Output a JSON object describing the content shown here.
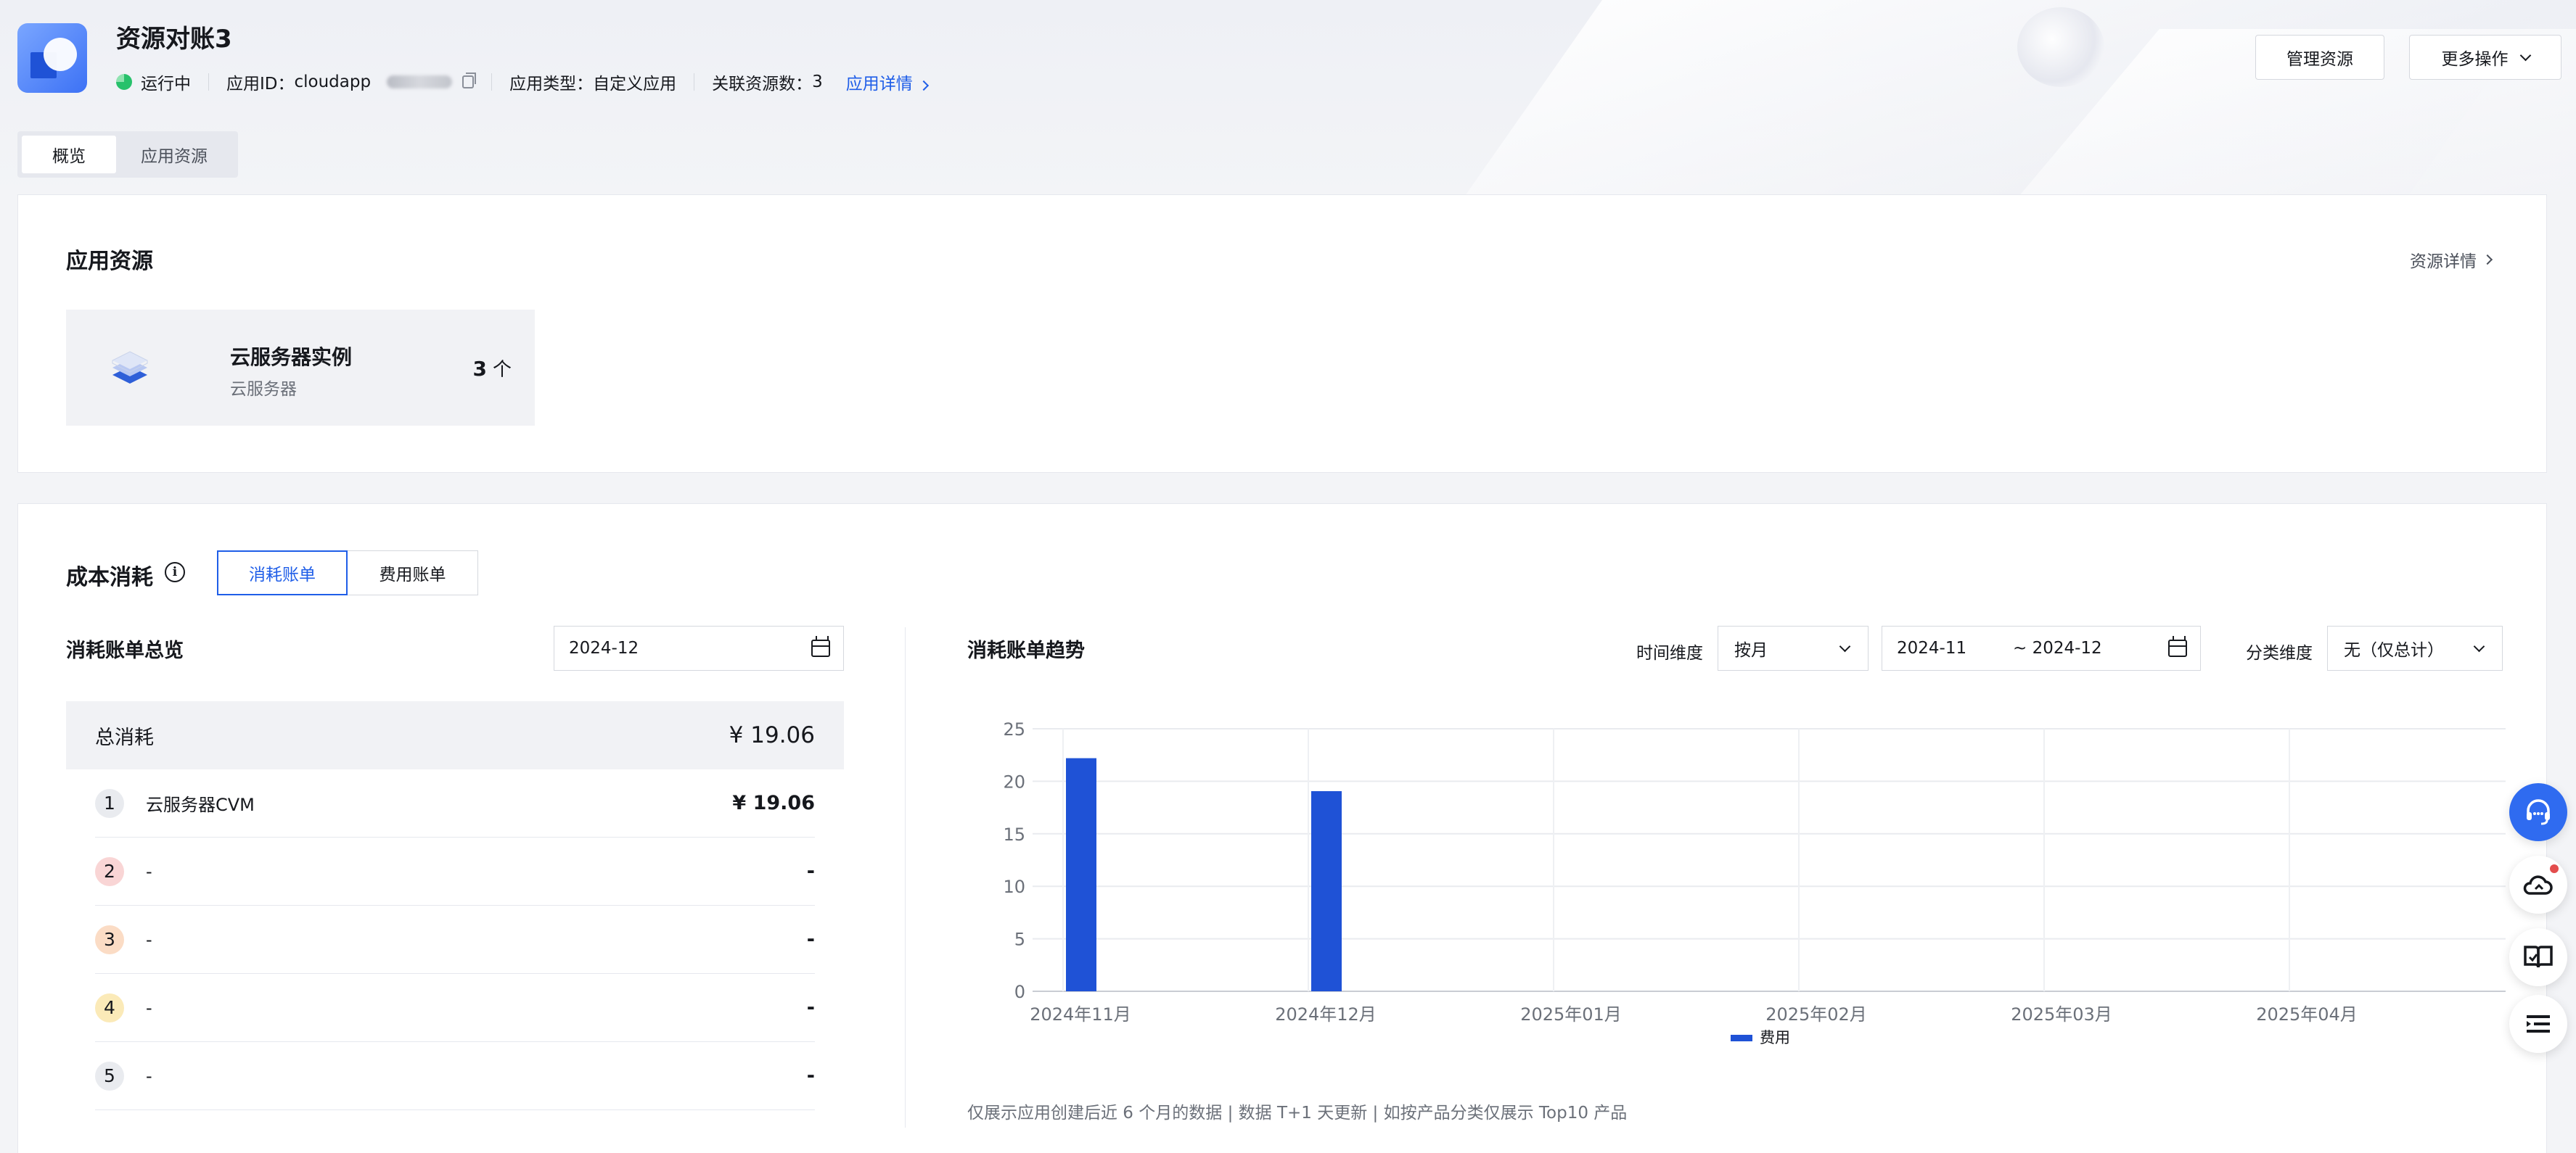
{
  "app": {
    "title": "资源对账3",
    "status": "运行中",
    "app_id_label": "应用ID：",
    "app_id_value": "cloudapp",
    "app_type_label": "应用类型：",
    "app_type_value": "自定义应用",
    "resource_count_label": "关联资源数：",
    "resource_count_value": "3",
    "detail_link": "应用详情"
  },
  "header_buttons": {
    "manage": "管理资源",
    "more": "更多操作"
  },
  "tabs": [
    {
      "label": "概览",
      "active": true
    },
    {
      "label": "应用资源",
      "active": false
    }
  ],
  "resources": {
    "title": "应用资源",
    "detail_link": "资源详情",
    "tile": {
      "name": "云服务器实例",
      "sub": "云服务器",
      "count": "3",
      "unit": "个"
    }
  },
  "cost": {
    "title": "成本消耗",
    "info_icon": "i",
    "segments": [
      "消耗账单",
      "费用账单"
    ],
    "overview": {
      "title": "消耗账单总览",
      "date": "2024-12",
      "total_label": "总消耗",
      "total_value": "¥ 19.06",
      "items": [
        {
          "rank": "1",
          "name": "云服务器CVM",
          "value": "¥ 19.06",
          "badge_color": "#e9ebef"
        },
        {
          "rank": "2",
          "name": "-",
          "value": "-",
          "badge_color": "#f9d5d5"
        },
        {
          "rank": "3",
          "name": "-",
          "value": "-",
          "badge_color": "#fbdcc5"
        },
        {
          "rank": "4",
          "name": "-",
          "value": "-",
          "badge_color": "#fbeab8"
        },
        {
          "rank": "5",
          "name": "-",
          "value": "-",
          "badge_color": "#e9ebef"
        }
      ]
    },
    "trend": {
      "title": "消耗账单趋势",
      "time_label": "时间维度",
      "time_value": "按月",
      "range_start": "2024-11",
      "range_end": "~ 2024-12",
      "category_label": "分类维度",
      "category_value": "无（仅总计）",
      "note": "仅展示应用创建后近 6 个月的数据 | 数据 T+1 天更新 | 如按产品分类仅展示 Top10 产品"
    }
  },
  "chart_data": {
    "type": "bar",
    "categories": [
      "2024年11月",
      "2024年12月",
      "2025年01月",
      "2025年02月",
      "2025年03月",
      "2025年04月"
    ],
    "series": [
      {
        "name": "费用",
        "values": [
          22.2,
          19.06,
          null,
          null,
          null,
          null
        ],
        "color": "#1f52d6"
      }
    ],
    "yticks": [
      "0",
      "5",
      "10",
      "15",
      "20",
      "25"
    ],
    "ylim": [
      0,
      25
    ],
    "grid": true,
    "legend": "bottom"
  },
  "colors": {
    "accent": "#1f5ee8",
    "bar": "#1f52d6",
    "status_green": "#27c16b"
  },
  "icons": {
    "float_tools": [
      "headset-icon",
      "cloud-bell-icon",
      "book-icon",
      "list-icon"
    ]
  }
}
